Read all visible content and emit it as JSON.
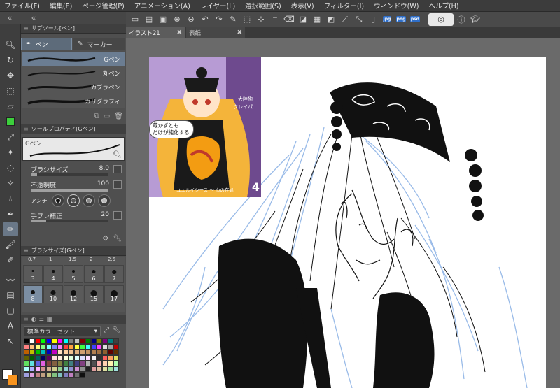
{
  "menu": [
    "ファイル(F)",
    "編集(E)",
    "ページ管理(P)",
    "アニメーション(A)",
    "レイヤー(L)",
    "選択範囲(S)",
    "表示(V)",
    "フィルター(I)",
    "ウィンドウ(W)",
    "ヘルプ(H)"
  ],
  "toolbar": {
    "file_badges": [
      "jpg",
      "png",
      "psd"
    ]
  },
  "tabs": [
    {
      "label": "イラスト21",
      "active": true
    },
    {
      "label": "表紙",
      "active": false
    }
  ],
  "subtool_panel": {
    "title": "サブツール[ペン]",
    "tabs": [
      "ペン",
      "マーカー"
    ],
    "brushes": [
      {
        "name": "Gペン",
        "selected": true
      },
      {
        "name": "丸ペン",
        "selected": false
      },
      {
        "name": "カブラペン",
        "selected": false
      },
      {
        "name": "カリグラフィ",
        "selected": false
      }
    ]
  },
  "tool_property": {
    "title": "ツールプロパティ[Gペン]",
    "preview_label": "Gペン",
    "brush_size_label": "ブラシサイズ",
    "brush_size_value": "8.0",
    "opacity_label": "不透明度",
    "opacity_value": "100",
    "opacity_fraction": 1.0,
    "brush_size_fraction": 0.08,
    "antialias_label": "アンチ",
    "stabilize_label": "手ブレ補正",
    "stabilize_value": "20",
    "stabilize_fraction": 0.2
  },
  "brush_size_panel": {
    "title": "ブラシサイズ[Gペン]",
    "top_labels": [
      "0.7",
      "1",
      "1.5",
      "2",
      "2.5"
    ],
    "sizes": [
      {
        "label": "3",
        "selected": false
      },
      {
        "label": "4",
        "selected": false
      },
      {
        "label": "5",
        "selected": false
      },
      {
        "label": "6",
        "selected": false
      },
      {
        "label": "7",
        "selected": false
      },
      {
        "label": "8",
        "selected": true
      },
      {
        "label": "10",
        "selected": false
      },
      {
        "label": "12",
        "selected": false
      },
      {
        "label": "15",
        "selected": false
      },
      {
        "label": "17",
        "selected": false
      }
    ]
  },
  "colorset_panel": {
    "selected": "標準カラーセット"
  },
  "reference_image": {
    "bubble_text_line1": "蔵かずとも",
    "bubble_text_line2": "だけが純化する",
    "side_text_1": "大陸狗",
    "side_text_2": "クレイパ",
    "caption": "ユエルイシース  ～ 心の在処",
    "number": "4"
  },
  "colors": {
    "foreground": "#ffffff",
    "background": "#f7931e",
    "accent": "#7b8ea3"
  }
}
